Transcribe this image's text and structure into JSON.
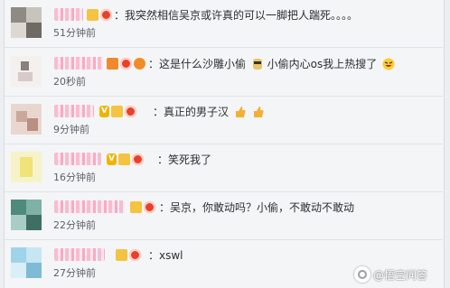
{
  "comments": [
    {
      "text": "：我突然相信吴京或许真的可以一脚把人踹死。。。。",
      "time": "51分钟前"
    },
    {
      "text": "：这是什么沙雕小偷",
      "text2": "小偷内心os我上热搜了",
      "time": "20秒前"
    },
    {
      "text": "：真正的男子汉",
      "time": "9分钟前"
    },
    {
      "text": "：笑死我了",
      "time": "16分钟前"
    },
    {
      "text": "：吴京，你敢动吗？小偷，不敢动不敢动",
      "time": "22分钟前"
    },
    {
      "text": "：xswl",
      "time": "27分钟前"
    }
  ],
  "watermark": {
    "label": "@悟空问答"
  },
  "colors": {
    "background": "#f4f5f7",
    "text": "#2b2f33",
    "time": "#5b6168",
    "divider": "#dfe2e6"
  }
}
